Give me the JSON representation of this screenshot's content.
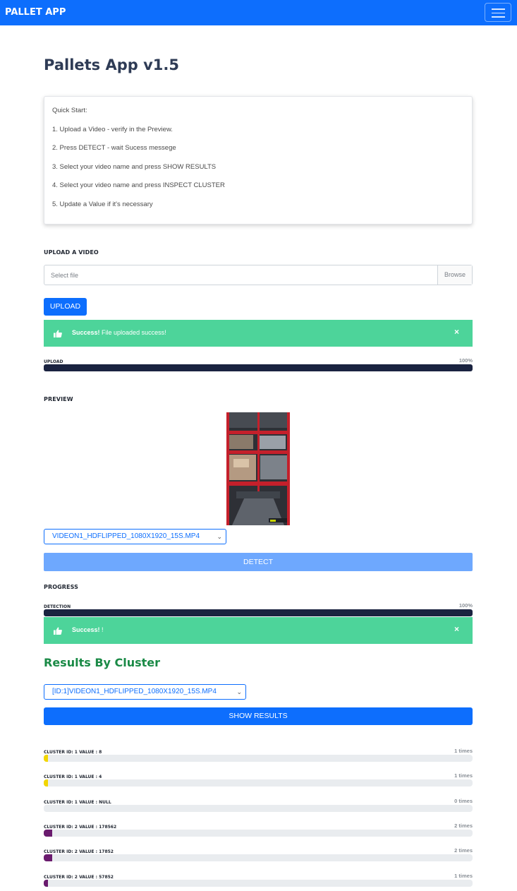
{
  "navbar": {
    "brand": "PALLET APP"
  },
  "page_title": "Pallets App v1.5",
  "quick_start": {
    "heading": "Quick Start:",
    "steps": [
      "1. Upload a Video - verify in the Preview.",
      "2. Press DETECT - wait Sucess messege",
      "3. Select your video name and press SHOW RESULTS",
      "4. Select your video name and press INSPECT CLUSTER",
      "5. Update a Value if it's necessary"
    ]
  },
  "upload": {
    "section_label": "UPLOAD A VIDEO",
    "placeholder": "Select file",
    "browse_label": "Browse",
    "button_label": "UPLOAD",
    "alert_strong": "Success!",
    "alert_text": " File uploaded success!",
    "close_glyph": "×",
    "progress_label": "UPLOAD",
    "progress_text": "100%",
    "progress": 1.0
  },
  "preview": {
    "section_label": "PREVIEW",
    "selected_video": "VIDEON1_HDFLIPPED_1080X1920_15S.MP4",
    "detect_label": "DETECT"
  },
  "progress": {
    "section_label": "PROGRESS",
    "detection_label": "DETECTION",
    "detection_text": "100%",
    "detection": 1.0,
    "alert_strong": "Success!",
    "alert_text": " !",
    "close_glyph": "×"
  },
  "results": {
    "title": "Results By Cluster",
    "selected": "[ID:1]VIDEON1_HDFLIPPED_1080X1920_15S.MP4",
    "show_label": "SHOW RESULTS",
    "clusters": [
      {
        "label": "CLUSTER ID: 1 VALUE : 8",
        "count": "1 times",
        "fraction": 0.01,
        "color": "#f2d600"
      },
      {
        "label": "CLUSTER ID: 1 VALUE : 4",
        "count": "1 times",
        "fraction": 0.01,
        "color": "#f2d600"
      },
      {
        "label": "CLUSTER ID: 1 VALUE : NULL",
        "count": "0 times",
        "fraction": 0.0,
        "color": "#f2d600"
      },
      {
        "label": "CLUSTER ID: 2 VALUE : 178562",
        "count": "2 times",
        "fraction": 0.02,
        "color": "#6a1b6e"
      },
      {
        "label": "CLUSTER ID: 2 VALUE : 17852",
        "count": "2 times",
        "fraction": 0.02,
        "color": "#6a1b6e"
      },
      {
        "label": "CLUSTER ID: 2 VALUE : 57852",
        "count": "1 times",
        "fraction": 0.01,
        "color": "#6a1b6e"
      }
    ]
  },
  "colors": {
    "primary": "#0d6efd",
    "success": "#4dd49a",
    "progress_dark": "#1a2340",
    "results_title": "#1a8a46"
  }
}
